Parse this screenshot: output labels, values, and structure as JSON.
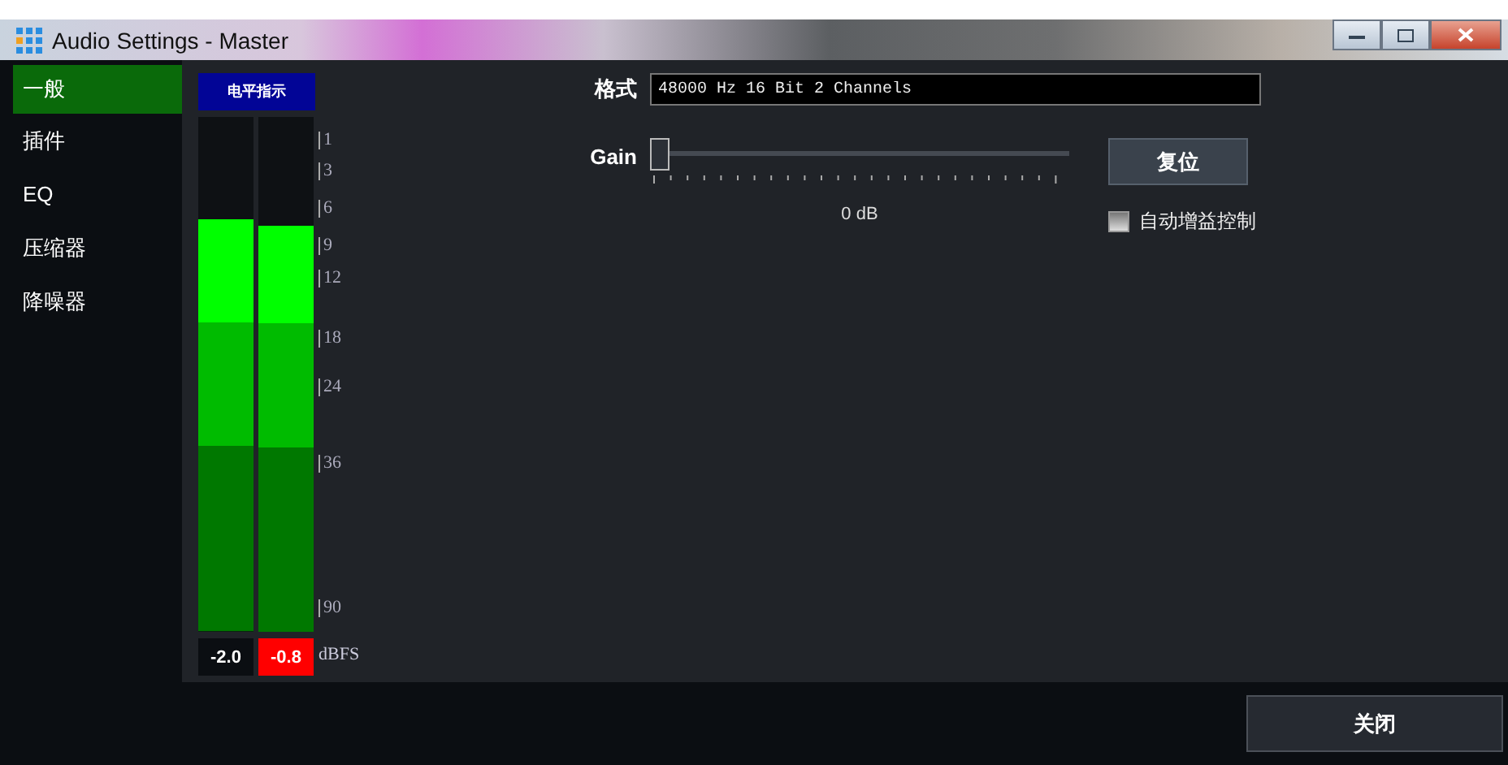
{
  "window": {
    "title": "Audio Settings - Master"
  },
  "sidebar": {
    "items": [
      {
        "label": "一般",
        "selected": true
      },
      {
        "label": "插件",
        "selected": false
      },
      {
        "label": "EQ",
        "selected": false
      },
      {
        "label": "压缩器",
        "selected": false
      },
      {
        "label": "降噪器",
        "selected": false
      }
    ]
  },
  "meter": {
    "title": "电平指示",
    "channels": [
      {
        "level": 0.8,
        "reading": "-2.0",
        "clipped": false
      },
      {
        "level": 0.79,
        "reading": "-0.8",
        "clipped": true
      }
    ],
    "scale": [
      "1",
      "3",
      "6",
      "9",
      "12",
      "18",
      "24",
      "36",
      "90"
    ],
    "unit": "dBFS"
  },
  "format": {
    "label": "格式",
    "value": "48000 Hz 16 Bit 2 Channels"
  },
  "gain": {
    "label": "Gain",
    "level": 0,
    "reading": "0 dB"
  },
  "reset_button": "复位",
  "auto_gain": {
    "label": "自动增益控制",
    "checked": false
  },
  "close_button": "关闭"
}
